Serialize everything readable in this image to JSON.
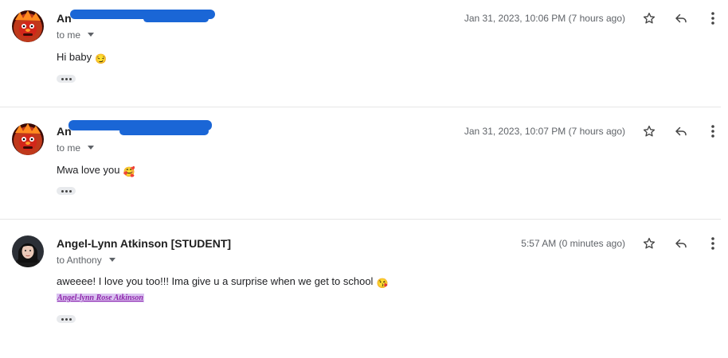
{
  "messages": [
    {
      "sender": "An",
      "sender_redacted": true,
      "recipient": "to me",
      "date": "Jan 31, 2023, 10:06 PM (7 hours ago)",
      "body": "Hi baby",
      "emoji": "😏",
      "avatar": "fire-character-avatar"
    },
    {
      "sender": "An",
      "sender_redacted": true,
      "recipient": "to me",
      "date": "Jan 31, 2023, 10:07 PM (7 hours ago)",
      "body": "Mwa love you",
      "emoji": "🥰",
      "avatar": "fire-character-avatar"
    },
    {
      "sender": "Angel-Lynn Atkinson [STUDENT]",
      "recipient": "to Anthony",
      "date": "5:57 AM (0 minutes ago)",
      "body": "aweeee! I love you too!!! Ima give u a surprise when we get to school",
      "emoji": "😘",
      "signature": "Angel-lynn Rose Atkinson",
      "avatar": "student-photo-avatar"
    }
  ],
  "icons": {
    "star": "star-icon",
    "reply": "reply-icon",
    "more": "more-vert-icon",
    "expand": "show-trimmed-content-icon"
  },
  "colors": {
    "redaction": "#1a66d6",
    "signature": "#8e24aa",
    "signature_highlight": "#d9c2f0"
  }
}
